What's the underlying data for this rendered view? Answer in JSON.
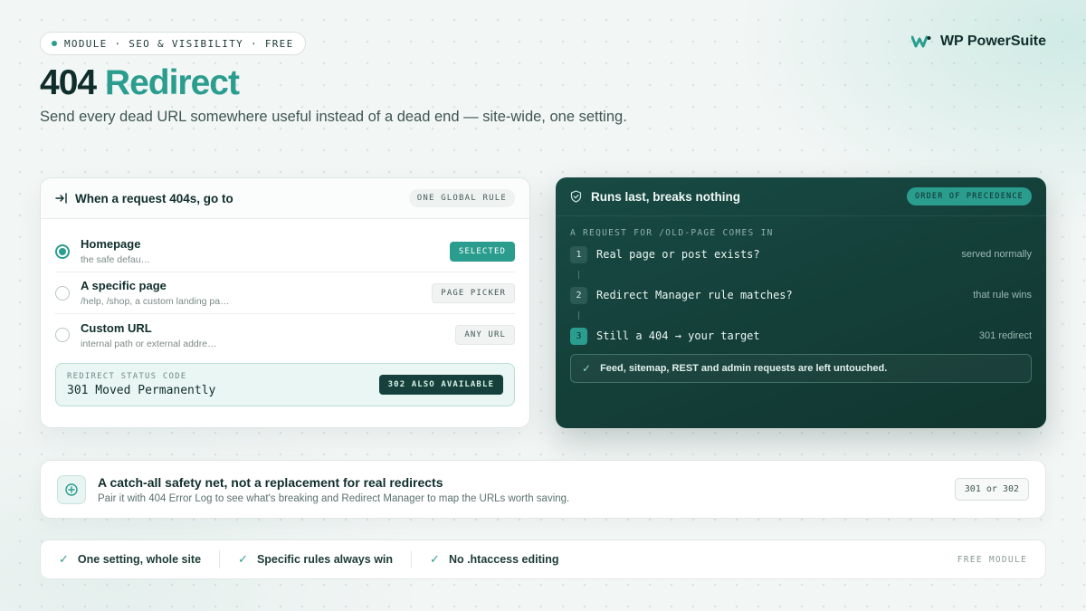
{
  "header": {
    "eyebrow": "MODULE · SEO & VISIBILITY · FREE",
    "brand": "WP PowerSuite",
    "title_main": "404",
    "title_accent": "Redirect",
    "subtitle": "Send every dead URL somewhere useful instead of a dead end — site-wide, one setting."
  },
  "left_card": {
    "title": "When a request 404s, go to",
    "pill": "ONE GLOBAL RULE",
    "options": [
      {
        "label": "Homepage",
        "sub": "the safe defau…",
        "tag": "SELECTED",
        "selected": true
      },
      {
        "label": "A specific page",
        "sub": "/help, /shop, a custom landing pa…",
        "tag": "PAGE PICKER",
        "selected": false
      },
      {
        "label": "Custom URL",
        "sub": "internal path or external addre…",
        "tag": "ANY URL",
        "selected": false
      }
    ],
    "status_label": "REDIRECT STATUS CODE",
    "status_value": "301 Moved Permanently",
    "status_badge": "302 ALSO AVAILABLE"
  },
  "right_card": {
    "title": "Runs last, breaks nothing",
    "pill": "ORDER OF PRECEDENCE",
    "request": "A REQUEST FOR /OLD-PAGE COMES IN",
    "steps": [
      {
        "num": "1",
        "text": "Real page or post exists?",
        "result": "served normally"
      },
      {
        "num": "2",
        "text": "Redirect Manager rule matches?",
        "result": "that rule wins"
      },
      {
        "num": "3",
        "text": "Still a 404 → your target",
        "result": "301 redirect"
      }
    ],
    "note": "Feed, sitemap, REST and admin requests are left untouched."
  },
  "net": {
    "title": "A catch-all safety net, not a replacement for real redirects",
    "text": "Pair it with 404 Error Log to see what's breaking and Redirect Manager to map the URLs worth saving.",
    "badge": "301 or 302"
  },
  "features": {
    "items": [
      "One setting, whole site",
      "Specific rules always win",
      "No .htaccess editing"
    ],
    "module": "FREE MODULE"
  },
  "colors": {
    "accent": "#2a9d8f",
    "dark": "#0f2e2b",
    "panel": "#184a44"
  }
}
